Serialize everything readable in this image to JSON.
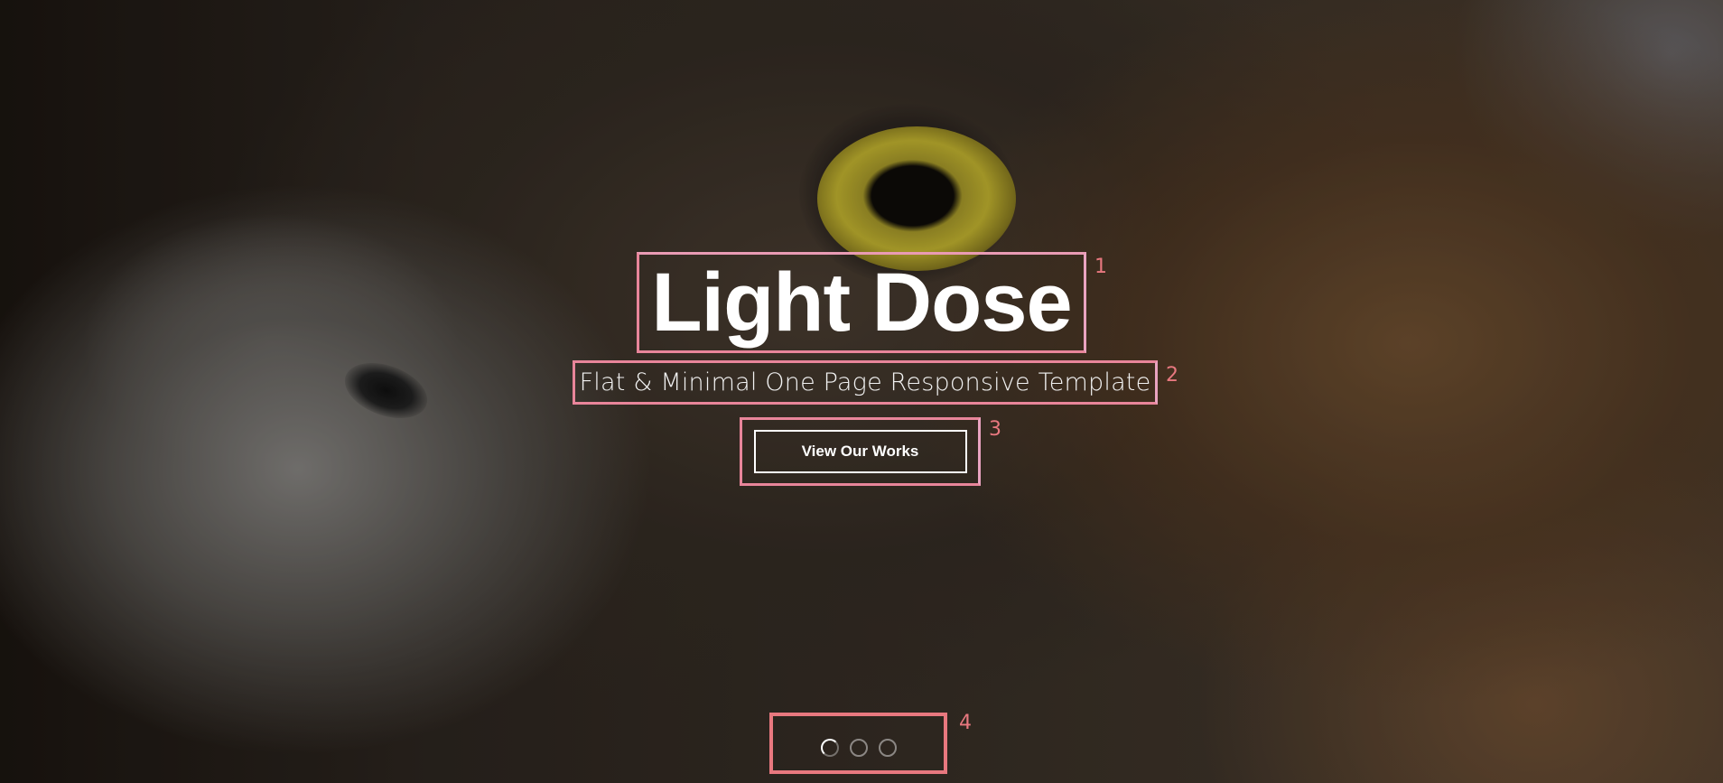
{
  "hero": {
    "title": "Light Dose",
    "subtitle": "Flat & Minimal One Page Responsive Template",
    "cta_label": "View Our Works"
  },
  "slider": {
    "dot_count": 3,
    "active_index": 0
  },
  "annotations": [
    "1",
    "2",
    "3",
    "4"
  ],
  "colors": {
    "highlight_border": "#e8859a",
    "annotation_text": "#e8787f",
    "text": "#ffffff"
  }
}
